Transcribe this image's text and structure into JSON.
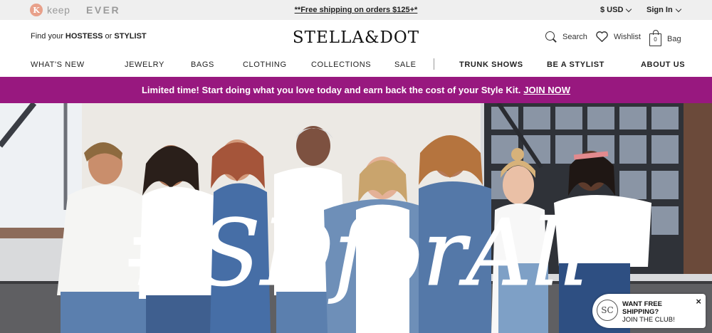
{
  "utility": {
    "keep_badge": "K",
    "keep_label": "keep",
    "ever_label": "EVER",
    "shipping": "**Free shipping on orders $125+*",
    "currency": "$ USD",
    "signin": "Sign In"
  },
  "header": {
    "find_prefix": "Find your ",
    "find_hostess": "HOSTESS",
    "find_or": " or ",
    "find_stylist": "STYLIST",
    "logo": "STELLA&DOT",
    "search_label": "Search",
    "wishlist_label": "Wishlist",
    "bag_count": "0",
    "bag_label": "Bag"
  },
  "nav": {
    "items": [
      "WHAT'S NEW",
      "JEWELRY",
      "BAGS",
      "CLOTHING",
      "COLLECTIONS",
      "SALE"
    ],
    "right_items": [
      "TRUNK SHOWS",
      "BE A STYLIST",
      "ABOUT US"
    ]
  },
  "promo": {
    "text": "Limited time! Start doing what you love today and earn back the cost of your Style Kit.",
    "cta": "JOIN NOW",
    "bg_color": "#98187f"
  },
  "hero": {
    "hashtag": "#SDforAll"
  },
  "popup": {
    "logo": "SC",
    "line1": "WANT FREE",
    "line2": "SHIPPING?",
    "line3": "JOIN THE CLUB!",
    "close": "×"
  },
  "icons": [
    "keep-logo-icon",
    "search-icon",
    "heart-icon",
    "bag-icon",
    "chevron-down-icon",
    "close-icon"
  ]
}
